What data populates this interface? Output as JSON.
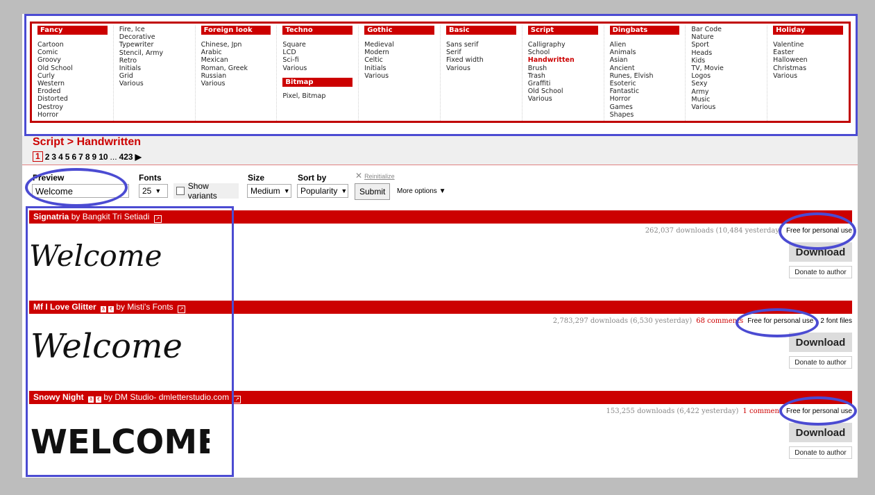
{
  "menu": {
    "col1": {
      "items": [
        "Cartoon",
        "Comic",
        "Groovy",
        "Old School",
        "Curly",
        "Western",
        "Eroded",
        "Distorted",
        "Destroy",
        "Horror"
      ],
      "head": "Fancy"
    },
    "col2": {
      "items": [
        "Fire, Ice",
        "Decorative",
        "Typewriter",
        "Stencil, Army",
        "Retro",
        "Initials",
        "Grid",
        "Various"
      ]
    },
    "col3": {
      "head": "Foreign look",
      "items": [
        "Chinese, Jpn",
        "Arabic",
        "Mexican",
        "Roman, Greek",
        "Russian",
        "Various"
      ]
    },
    "col4": {
      "head": "Techno",
      "items": [
        "Square",
        "LCD",
        "Sci-fi",
        "Various"
      ],
      "head2": "Bitmap",
      "items2": [
        "Pixel, Bitmap"
      ]
    },
    "col5": {
      "head": "Gothic",
      "items": [
        "Medieval",
        "Modern",
        "Celtic",
        "Initials",
        "Various"
      ]
    },
    "col6": {
      "head": "Basic",
      "items": [
        "Sans serif",
        "Serif",
        "Fixed width",
        "Various"
      ]
    },
    "col7": {
      "head": "Script",
      "items": [
        "Calligraphy",
        "School",
        "Handwritten",
        "Brush",
        "Trash",
        "Graffiti",
        "Old School",
        "Various"
      ],
      "active": "Handwritten"
    },
    "col8": {
      "head": "Dingbats",
      "items": [
        "Alien",
        "Animals",
        "Asian",
        "Ancient",
        "Runes, Elvish",
        "Esoteric",
        "Fantastic",
        "Horror",
        "Games",
        "Shapes"
      ]
    },
    "col9": {
      "items": [
        "Bar Code",
        "Nature",
        "Sport",
        "Heads",
        "Kids",
        "TV, Movie",
        "Logos",
        "Sexy",
        "Army",
        "Music",
        "Various"
      ]
    },
    "col10": {
      "head": "Holiday",
      "items": [
        "Valentine",
        "Easter",
        "Halloween",
        "Christmas",
        "Various"
      ]
    }
  },
  "breadcrumb": "Script > Handwritten",
  "pagination": {
    "current": "1",
    "pages": [
      "2",
      "3",
      "4",
      "5",
      "6",
      "7",
      "8",
      "9",
      "10"
    ],
    "ellipsis": "...",
    "last": "423",
    "next_icon": "▶"
  },
  "filters": {
    "preview_label": "Preview",
    "preview_value": "Welcome",
    "fonts_label": "Fonts",
    "fonts_value": "25",
    "show_variants": "Show variants",
    "size_label": "Size",
    "size_value": "Medium",
    "sort_label": "Sort by",
    "sort_value": "Popularity",
    "submit": "Submit",
    "more_options": "More options",
    "reinitialize": "Reinitialize"
  },
  "fonts": [
    {
      "name": "Signatria",
      "by": "by Bangkit Tri Setiadi",
      "downloads": "262,037 downloads (10,484 yesterday)",
      "comments": "",
      "license": "Free for personal use",
      "files": "",
      "download": "Download",
      "donate": "Donate to author",
      "sample": "Welcome"
    },
    {
      "name": "Mf I Love Glitter",
      "by": "by Misti's Fonts",
      "downloads": "2,783,297 downloads (6,530 yesterday)",
      "comments": "68 comments",
      "license": "Free for personal use",
      "files": "- 2 font files",
      "download": "Download",
      "donate": "Donate to author",
      "sample": "Welcome"
    },
    {
      "name": "Snowy Night",
      "by": "by DM Studio- dmletterstudio.com",
      "downloads": "153,255 downloads (6,422 yesterday)",
      "comments": "1 comment",
      "license": "Free for personal use",
      "files": "",
      "download": "Download",
      "donate": "Donate to author",
      "sample": "WELCOME"
    }
  ],
  "colors": {
    "accent": "#cc0000",
    "annotation": "#4b4bd2"
  },
  "icons": {
    "external_link": "external-link-icon",
    "next_page": "next-page-icon",
    "dropdown": "dropdown-triangle-icon"
  }
}
